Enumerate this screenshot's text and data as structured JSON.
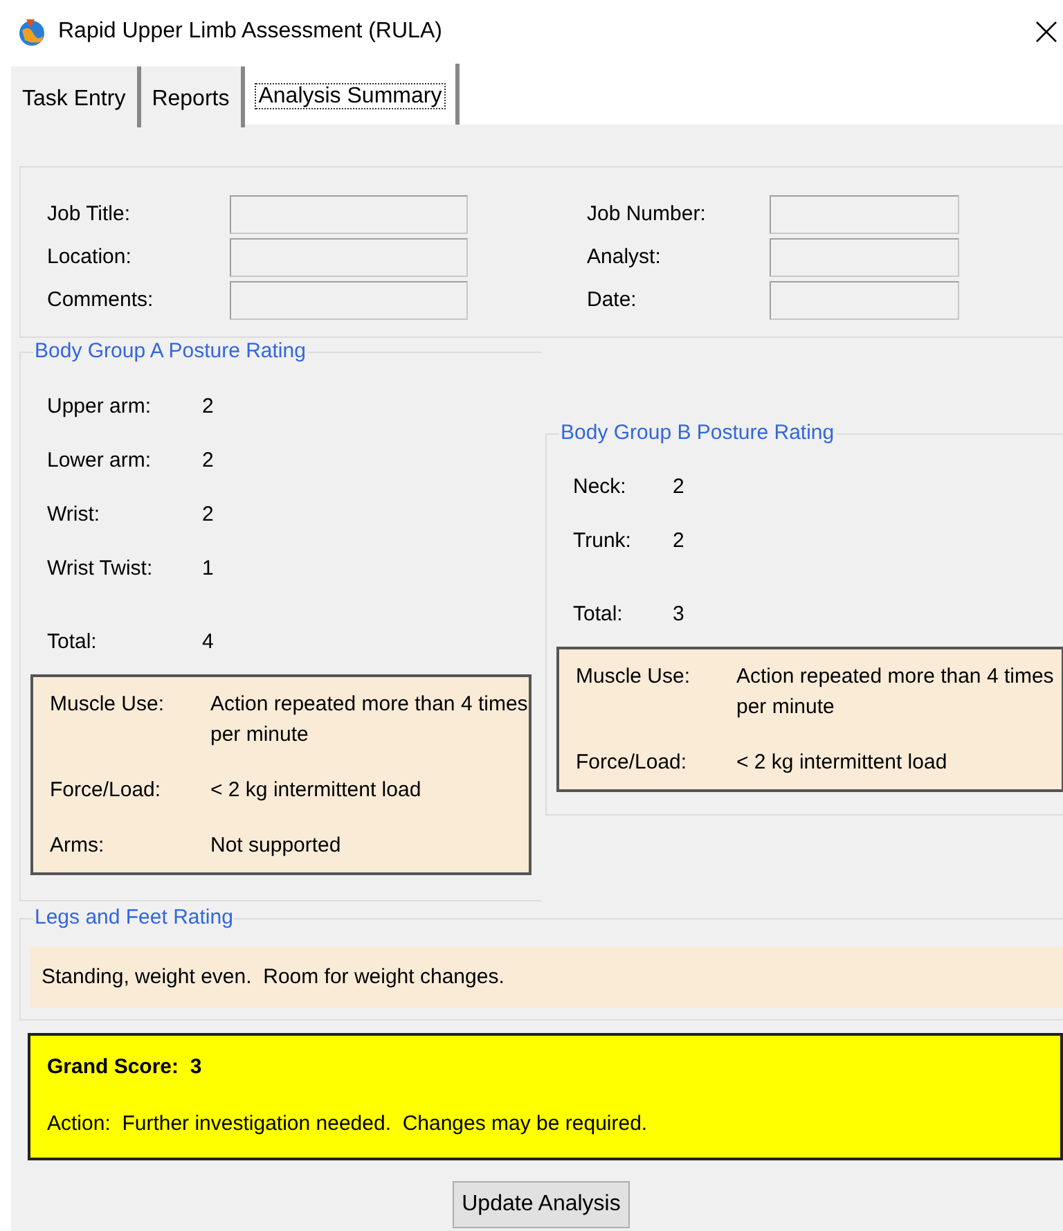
{
  "window": {
    "title": "Rapid Upper Limb Assessment (RULA)"
  },
  "tabs": [
    {
      "label": "Task Entry",
      "selected": false
    },
    {
      "label": "Reports",
      "selected": false
    },
    {
      "label": "Analysis Summary",
      "selected": true
    }
  ],
  "job_info": {
    "left": [
      {
        "label": "Job Title:"
      },
      {
        "label": "Location:"
      },
      {
        "label": "Comments:"
      }
    ],
    "right": [
      {
        "label": "Job Number:"
      },
      {
        "label": "Analyst:"
      },
      {
        "label": "Date:"
      }
    ]
  },
  "body_group_a": {
    "title": "Body Group A Posture Rating",
    "ratings": [
      {
        "label": "Upper arm:",
        "value": "2"
      },
      {
        "label": "Lower arm:",
        "value": "2"
      },
      {
        "label": "Wrist:",
        "value": "2"
      },
      {
        "label": "Wrist Twist:",
        "value": "1"
      }
    ],
    "total": {
      "label": "Total:",
      "value": "4"
    },
    "factors": [
      {
        "label": "Muscle Use:",
        "value": "Action repeated more than 4 times per minute"
      },
      {
        "label": "Force/Load:",
        "value": "< 2 kg intermittent load"
      },
      {
        "label": "Arms:",
        "value": "Not supported"
      }
    ]
  },
  "body_group_b": {
    "title": "Body Group B Posture Rating",
    "ratings": [
      {
        "label": "Neck:",
        "value": "2"
      },
      {
        "label": "Trunk:",
        "value": "2"
      }
    ],
    "total": {
      "label": "Total:",
      "value": "3"
    },
    "factors": [
      {
        "label": "Muscle Use:",
        "value": "Action repeated more than 4 times per minute"
      },
      {
        "label": "Force/Load:",
        "value": "< 2 kg intermittent load"
      }
    ]
  },
  "legs_and_feet": {
    "title": "Legs and Feet Rating",
    "text": "Standing, weight even.  Room for weight changes."
  },
  "grand_score": {
    "label": "Grand Score:  3",
    "action": "Action:  Further investigation needed.  Changes may be required."
  },
  "buttons": [
    "Update Analysis"
  ]
}
